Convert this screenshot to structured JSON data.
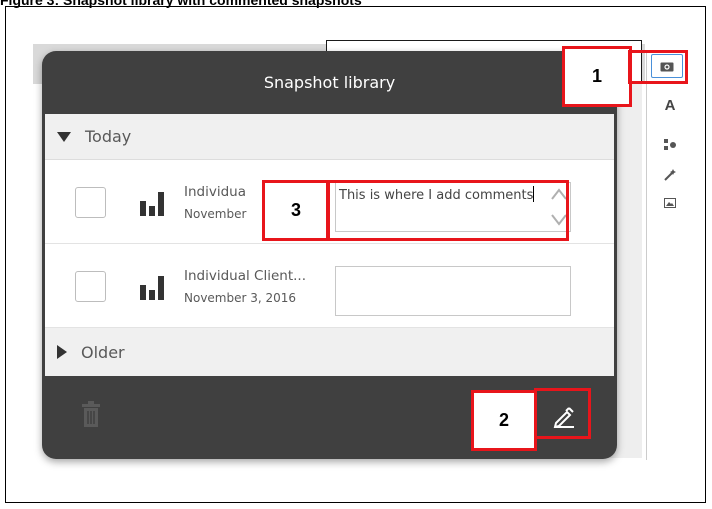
{
  "figure": {
    "caption": "Figure 3: Snapshot library with commented snapshots"
  },
  "dialog": {
    "title": "Snapshot library",
    "sections": [
      {
        "label": "Today",
        "expanded": true
      },
      {
        "label": "Older",
        "expanded": false
      }
    ],
    "snapshots": [
      {
        "title": "Individua",
        "date": "November",
        "comment": "This is where I add comments"
      },
      {
        "title": "Individual Client...",
        "date": "November 3, 2016",
        "comment": ""
      }
    ]
  },
  "toolbar": {
    "icons": [
      "camera-icon",
      "text-icon",
      "shapes-icon",
      "magic-wand-icon",
      "image-icon"
    ],
    "text_tool_label": "A"
  },
  "callouts": {
    "one": "1",
    "two": "2",
    "three": "3"
  },
  "colors": {
    "dialog_bg": "#404040",
    "callout_red": "#e8151b",
    "camera_border": "#4a90d9"
  }
}
